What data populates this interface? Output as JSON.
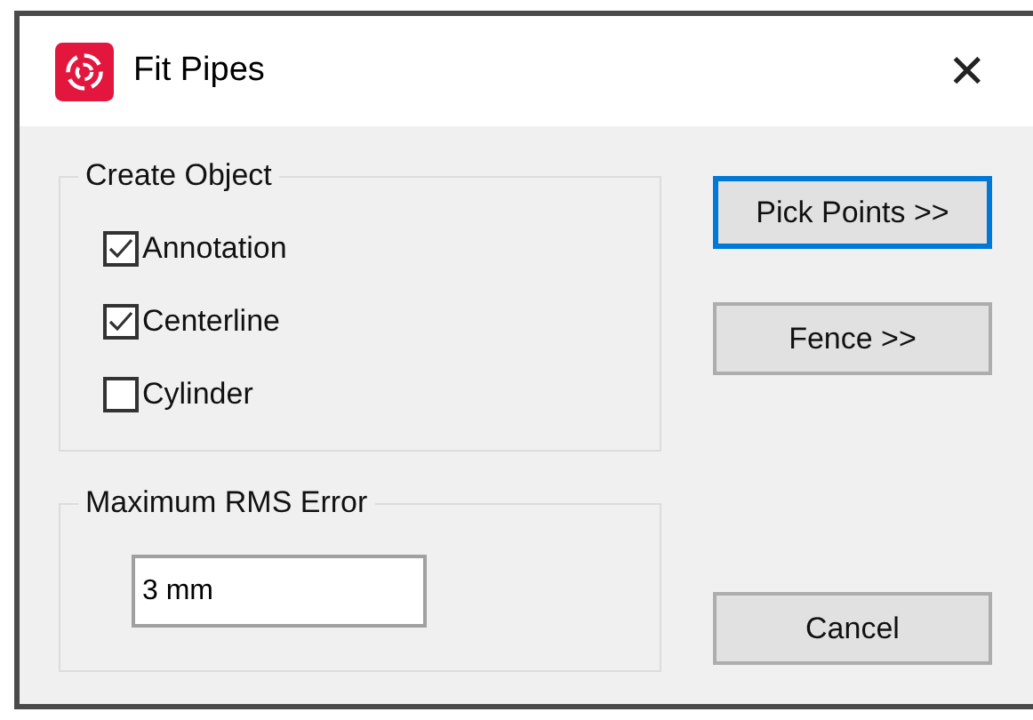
{
  "window": {
    "title": "Fit Pipes",
    "close": "✕"
  },
  "create_object": {
    "label": "Create Object",
    "options": [
      {
        "label": "Annotation",
        "checked": true
      },
      {
        "label": "Centerline",
        "checked": true
      },
      {
        "label": "Cylinder",
        "checked": false
      }
    ]
  },
  "rms_error": {
    "label": "Maximum RMS Error",
    "value": "3 mm"
  },
  "buttons": [
    {
      "label": "Pick Points >>",
      "focused": true
    },
    {
      "label": "Fence >>",
      "focused": false
    },
    {
      "label": "Cancel",
      "focused": false
    }
  ]
}
